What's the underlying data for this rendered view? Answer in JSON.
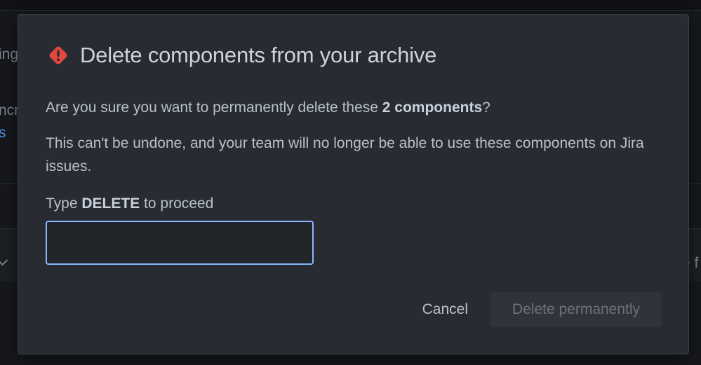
{
  "background": {
    "fragments": [
      "ing",
      "ncr",
      "s",
      "e f"
    ]
  },
  "modal": {
    "icon": "warning-icon",
    "title": "Delete components from your archive",
    "question_prefix": "Are you sure you want to permanently delete these ",
    "question_bold": "2 components",
    "question_suffix": "?",
    "warning_text": "This can't be undone, and your team will no longer be able to use these components on Jira issues.",
    "confirm_prefix": "Type ",
    "confirm_bold": "DELETE",
    "confirm_suffix": " to proceed",
    "input_value": "",
    "cancel_label": "Cancel",
    "delete_label": "Delete permanently"
  },
  "colors": {
    "danger": "#e2483d",
    "focus_border": "#85b8ff",
    "modal_bg": "#282c32"
  }
}
